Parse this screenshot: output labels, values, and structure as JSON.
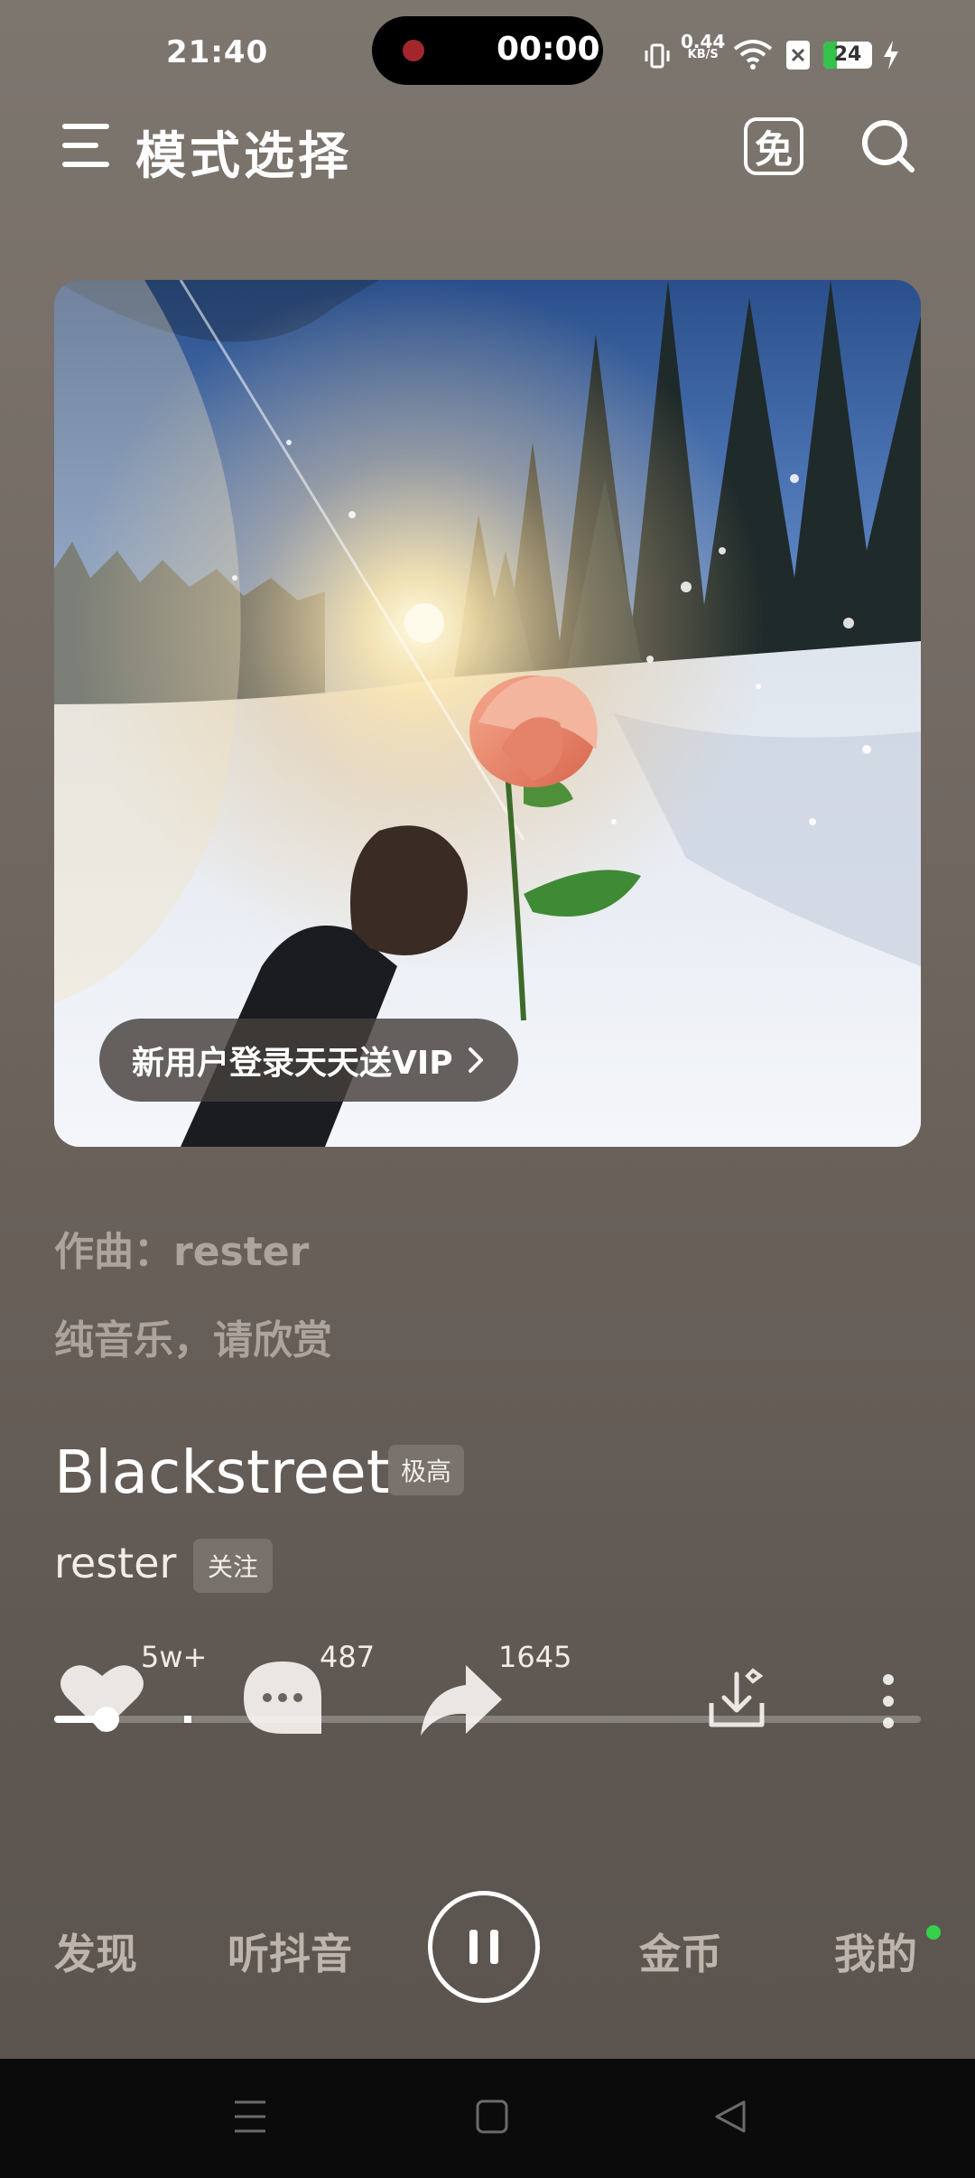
{
  "status_bar": {
    "time": "21:40",
    "recording_time": "00:00",
    "net_speed_value": "0.44",
    "net_speed_unit": "KB/S",
    "battery_level": "24"
  },
  "header": {
    "title": "模式选择",
    "free_badge": "免"
  },
  "banner": {
    "vip_text": "新用户登录天天送VIP"
  },
  "lyrics": {
    "line1": "作曲：rester",
    "line2": "纯音乐，请欣赏"
  },
  "song": {
    "title": "Blackstreet",
    "quality": "极高",
    "artist": "rester",
    "follow_label": "关注"
  },
  "actions": {
    "like_count": "5w+",
    "comment_count": "487",
    "share_count": "1645"
  },
  "playback": {
    "progress_fraction": 0.06
  },
  "tabs": {
    "discover": "发现",
    "listen": "听抖音",
    "coins": "金币",
    "mine": "我的"
  },
  "colors": {
    "background": "#736b64",
    "accent_green": "#36d14b"
  }
}
